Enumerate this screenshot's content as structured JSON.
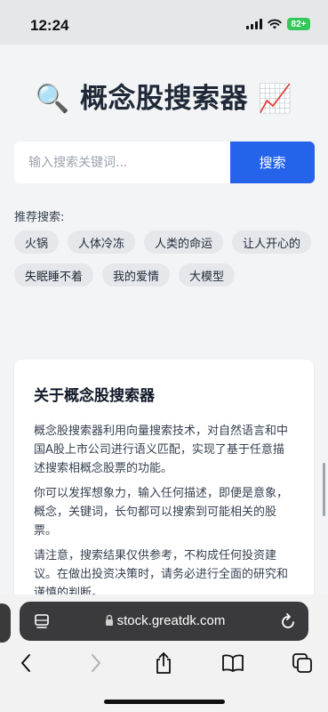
{
  "status_bar": {
    "time": "12:24",
    "battery": "82+"
  },
  "page": {
    "title": "🔍 概念股搜索器 📈"
  },
  "search": {
    "placeholder": "输入搜索关键词...",
    "value": "",
    "button_label": "搜索"
  },
  "recommend": {
    "label": "推荐搜索:",
    "tags": [
      "火锅",
      "人体冷冻",
      "人类的命运",
      "让人开心的",
      "失眠睡不着",
      "我的爱情",
      "大模型"
    ]
  },
  "about": {
    "title": "关于概念股搜索器",
    "paragraphs": [
      "概念股搜索器利用向量搜索技术，对自然语言和中国A股上市公司进行语义匹配，实现了基于任意描述搜索相概念股票的功能。",
      "你可以发挥想象力，输入任何描述，即便是意象，概念，关键词，长句都可以搜索到可能相关的股票。",
      "请注意，搜索结果仅供参考，不构成任何投资建议。在做出投资决策时，请务必进行全面的研究和谨慎的判断。"
    ]
  },
  "browser": {
    "url": "stock.greatdk.com"
  },
  "colors": {
    "accent": "#2563eb",
    "battery": "#34c759"
  },
  "icons": [
    "signal-icon",
    "wifi-icon",
    "battery-icon",
    "tab-layout-icon",
    "lock-icon",
    "reload-icon",
    "back-icon",
    "forward-icon",
    "share-icon",
    "bookmarks-icon",
    "tabs-icon"
  ]
}
